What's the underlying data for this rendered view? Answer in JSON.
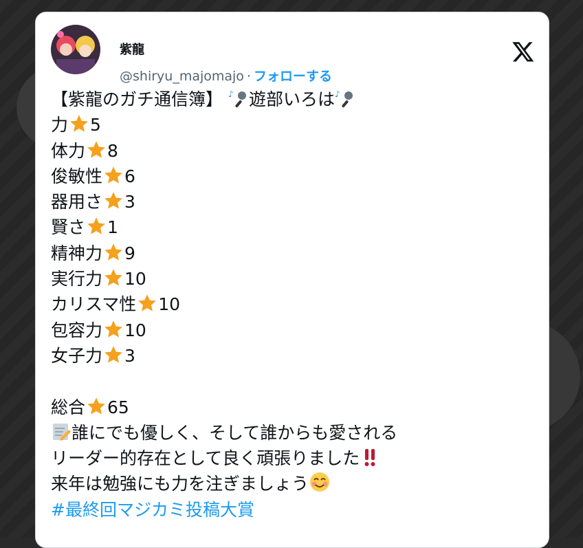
{
  "post": {
    "author_name": "紫龍",
    "author_handle": "@shiryu_majomajo",
    "separator": "·",
    "follow_label": "フォローする",
    "title_line": {
      "before": "【紫龍のガチ通信簿】",
      "middle": "遊部いろは"
    },
    "stats": [
      {
        "label": "力",
        "value": "5"
      },
      {
        "label": "体力",
        "value": "8"
      },
      {
        "label": "俊敏性",
        "value": "6"
      },
      {
        "label": "器用さ",
        "value": "3"
      },
      {
        "label": "賢さ",
        "value": "1"
      },
      {
        "label": "精神力",
        "value": "9"
      },
      {
        "label": "実行力",
        "value": "10"
      },
      {
        "label": "カリスマ性",
        "value": "10"
      },
      {
        "label": "包容力",
        "value": "10"
      },
      {
        "label": "女子力",
        "value": "3"
      }
    ],
    "total": {
      "label": "総合",
      "value": "65"
    },
    "comment_lines": [
      "誰にでも優しく、そして誰からも愛される",
      "リーダー的存在として良く頑張りました",
      "来年は勉強にも力を注ぎましょう"
    ],
    "hashtag": "#最終回マジカミ投稿大賞"
  },
  "icons": {
    "logo": "x-logo-icon",
    "star": "star-icon",
    "mic": "microphone-notes-icon",
    "memo": "memo-icon",
    "exclamation": "double-exclamation-icon",
    "smile": "smiling-face-icon"
  },
  "colors": {
    "link": "#1d9bf0",
    "text": "#0f1419",
    "muted": "#536471",
    "star": "#f4a11d"
  }
}
